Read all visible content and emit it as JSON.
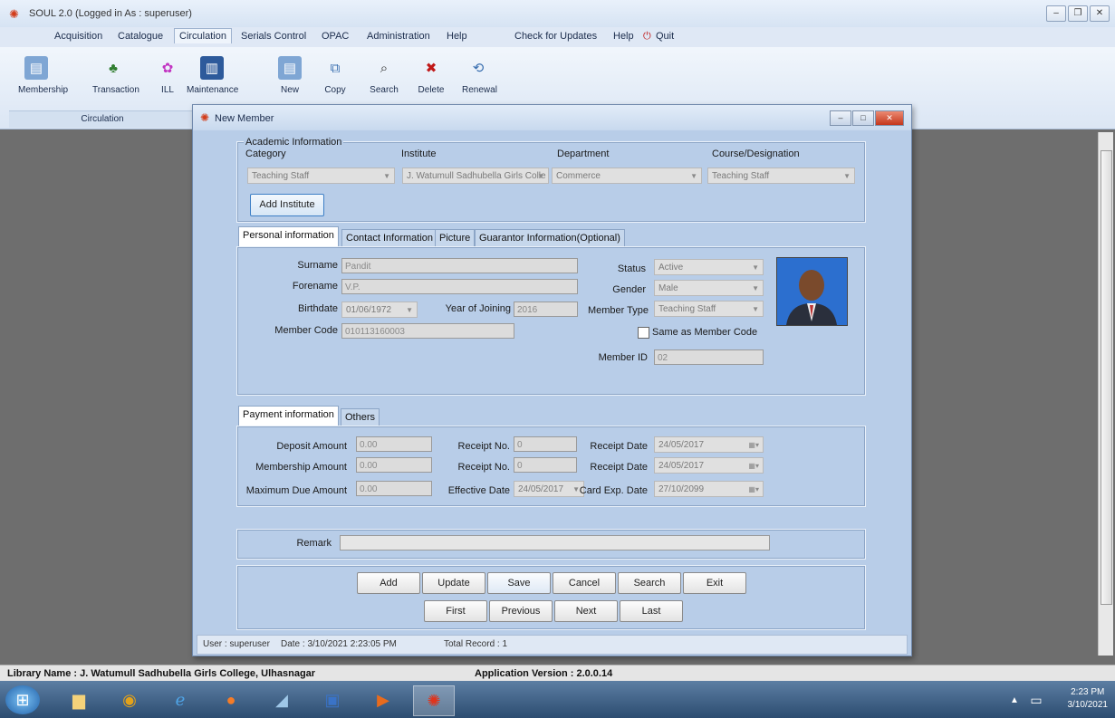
{
  "app": {
    "title": "SOUL 2.0  (Logged in As : superuser)",
    "menu": [
      "Acquisition",
      "Catalogue",
      "Circulation",
      "Serials Control",
      "OPAC",
      "Administration",
      "Help"
    ],
    "menu_right": [
      "Check for Updates",
      "Help",
      "Quit"
    ],
    "ribbon": {
      "items": [
        "Membership",
        "Transaction",
        "ILL",
        "Maintenance",
        "New",
        "Copy",
        "Search",
        "Delete",
        "Renewal"
      ],
      "group_label": "Circulation"
    }
  },
  "dialog": {
    "title": "New Member",
    "academic": {
      "legend": "Academic Information",
      "labels": {
        "category": "Category",
        "institute": "Institute",
        "department": "Department",
        "course": "Course/Designation"
      },
      "values": {
        "category": "Teaching Staff",
        "institute": "J. Watumull Sadhubella Girls Colle",
        "department": "Commerce",
        "course": "Teaching Staff"
      },
      "add_institute": "Add Institute"
    },
    "personal_tabs": [
      "Personal information",
      "Contact Information",
      "Picture",
      "Guarantor Information(Optional)"
    ],
    "personal": {
      "surname_label": "Surname",
      "surname": "Pandit",
      "forename_label": "Forename",
      "forename": "V.P.",
      "birthdate_label": "Birthdate",
      "birthdate": "01/06/1972",
      "year_joining_label": "Year of Joining",
      "year_joining": "2016",
      "member_code_label": "Member Code",
      "member_code": "010113160003",
      "status_label": "Status",
      "status": "Active",
      "gender_label": "Gender",
      "gender": "Male",
      "member_type_label": "Member Type",
      "member_type": "Teaching Staff",
      "same_as_label": "Same as Member Code",
      "member_id_label": "Member ID",
      "member_id": "02"
    },
    "payment_tabs": [
      "Payment information",
      "Others"
    ],
    "payment": {
      "deposit_label": "Deposit Amount",
      "deposit": "0.00",
      "membership_label": "Membership Amount",
      "membership": "0.00",
      "max_due_label": "Maximum Due Amount",
      "max_due": "0.00",
      "receipt1_label": "Receipt No.",
      "receipt1": "0",
      "receipt2_label": "Receipt No.",
      "receipt2": "0",
      "effective_label": "Effective Date",
      "effective": "24/05/2017",
      "receipt_date1_label": "Receipt Date",
      "receipt_date1": "24/05/2017",
      "receipt_date2_label": "Receipt Date",
      "receipt_date2": "24/05/2017",
      "card_exp_label": "Card Exp. Date",
      "card_exp": "27/10/2099"
    },
    "remark_label": "Remark",
    "buttons_row1": [
      "Add",
      "Update",
      "Save",
      "Cancel",
      "Search",
      "Exit"
    ],
    "buttons_row2": [
      "First",
      "Previous",
      "Next",
      "Last"
    ],
    "status": {
      "user": "User : superuser",
      "date": "Date : 3/10/2021 2:23:05 PM",
      "total": "Total Record : 1"
    }
  },
  "footer": {
    "library": "Library Name : J. Watumull Sadhubella Girls College, Ulhasnagar",
    "version": "Application Version : 2.0.0.14"
  },
  "taskbar": {
    "time": "2:23 PM",
    "date": "3/10/2021"
  }
}
